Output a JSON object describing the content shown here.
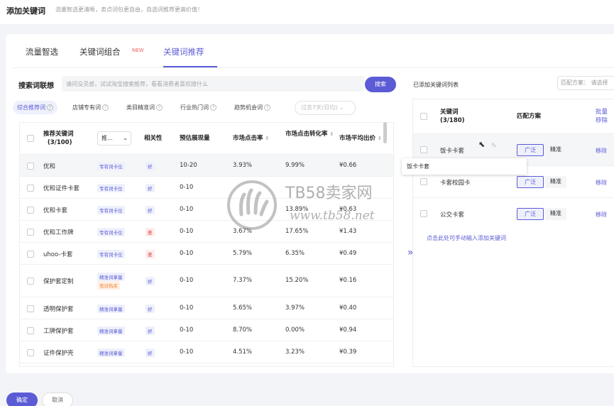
{
  "header": {
    "title": "添加关键词",
    "subtitle": "流量智选更清晰，卖点词包更自由，自选词推荐更高价值！"
  },
  "tabs": [
    {
      "label": "流量智选"
    },
    {
      "label": "关键词组合",
      "badge": "NEW"
    },
    {
      "label": "关键词推荐",
      "active": true
    }
  ],
  "search": {
    "label": "搜索词联想",
    "placeholder": "请问没灵感，试试淘宝搜索推荐，看看消费者喜欢搜什么",
    "button": "搜索"
  },
  "filters": [
    {
      "label": "综合推荐词",
      "active": true
    },
    {
      "label": "店铺专有词"
    },
    {
      "label": "类目精准词"
    },
    {
      "label": "行业热门词"
    },
    {
      "label": "趋势机会词"
    }
  ],
  "date_select": "过去7天(日均)",
  "table": {
    "headers": {
      "keyword": "推荐关键词",
      "keyword_count": "(3/100)",
      "dropdown": "推...",
      "relevance": "相关性",
      "impressions": "预估展现量",
      "ctr": "市场点击率",
      "cvr": "市场点击转化率",
      "avg_bid": "市场平均出价"
    },
    "rows": [
      {
        "keyword": "优和",
        "tags": [
          "专有词卡位"
        ],
        "rel": "好",
        "rel_type": "good",
        "imp": "10-20",
        "ctr": "3.93%",
        "cvr": "9.99%",
        "bid": "¥0.66"
      },
      {
        "keyword": "优和证件卡套",
        "tags": [
          "专有词卡位"
        ],
        "rel": "好",
        "rel_type": "good",
        "imp": "0-10",
        "ctr": "",
        "cvr": "",
        "bid": ""
      },
      {
        "keyword": "优和卡套",
        "tags": [
          "专有词卡位"
        ],
        "rel": "好",
        "rel_type": "good",
        "imp": "0-10",
        "ctr": "",
        "cvr": "13.89%",
        "bid": "¥0.63"
      },
      {
        "keyword": "优和工作牌",
        "tags": [
          "专有词卡位"
        ],
        "rel": "差",
        "rel_type": "bad",
        "imp": "0-10",
        "ctr": "3.67%",
        "cvr": "17.65%",
        "bid": "¥1.43"
      },
      {
        "keyword": "uhoo-卡套",
        "tags": [
          "专有词卡位"
        ],
        "rel": "差",
        "rel_type": "bad",
        "imp": "0-10",
        "ctr": "5.79%",
        "cvr": "6.35%",
        "bid": "¥0.49"
      },
      {
        "keyword": "保护套定制",
        "tags": [
          "精准词拿量",
          "竞对热买"
        ],
        "rel": "好",
        "rel_type": "good",
        "imp": "0-10",
        "ctr": "7.37%",
        "cvr": "15.20%",
        "bid": "¥0.16"
      },
      {
        "keyword": "透明保护套",
        "tags": [
          "精准词拿量"
        ],
        "rel": "好",
        "rel_type": "good",
        "imp": "0-10",
        "ctr": "5.65%",
        "cvr": "3.97%",
        "bid": "¥0.40"
      },
      {
        "keyword": "工牌保护套",
        "tags": [
          "精准词拿量"
        ],
        "rel": "好",
        "rel_type": "good",
        "imp": "0-10",
        "ctr": "8.70%",
        "cvr": "0.00%",
        "bid": "¥0.94"
      },
      {
        "keyword": "证件保护壳",
        "tags": [
          "精准词拿量"
        ],
        "rel": "好",
        "rel_type": "good",
        "imp": "0-10",
        "ctr": "4.51%",
        "cvr": "3.23%",
        "bid": "¥0.39"
      }
    ]
  },
  "right": {
    "title": "已添加关键词列表",
    "match_label": "匹配方案： 请选择",
    "headers": {
      "keyword": "关键词",
      "count": "(3/180)",
      "match": "匹配方案",
      "batch": "批量",
      "batch2": "移除"
    },
    "rows": [
      {
        "keyword": "饭卡卡套",
        "broad": "广泛",
        "exact": "精准",
        "remove": "移除"
      },
      {
        "keyword": "卡套校园卡",
        "broad": "广泛",
        "exact": "精准",
        "remove": "移除"
      },
      {
        "keyword": "公交卡套",
        "broad": "广泛",
        "exact": "精准",
        "remove": "移除"
      }
    ],
    "manual_link": "点击此处可手动输入添加关键词"
  },
  "tooltip": "饭卡卡套",
  "footer": {
    "ok": "确定",
    "cancel": "取消"
  },
  "watermark": {
    "line1": "TB58卖家网",
    "line2": "www.tb58.net"
  },
  "colors": {
    "accent": "#5b5bd6",
    "bad": "#e04040",
    "warn": "#f08030"
  }
}
